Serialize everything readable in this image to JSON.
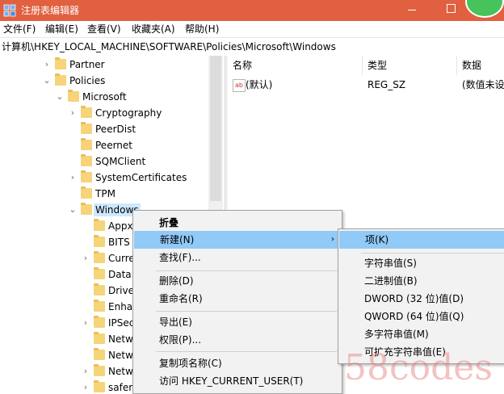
{
  "window": {
    "title": "注册表编辑器"
  },
  "menu": [
    "文件(F)",
    "编辑(E)",
    "查看(V)",
    "收藏夹(A)",
    "帮助(H)"
  ],
  "address": "计算机\\HKEY_LOCAL_MACHINE\\SOFTWARE\\Policies\\Microsoft\\Windows",
  "tree": [
    {
      "label": "Partner",
      "expand": "collapsed"
    },
    {
      "label": "Policies",
      "expand": "expanded"
    },
    {
      "label": "Microsoft",
      "expand": "expanded"
    },
    {
      "label": "Cryptography",
      "expand": "collapsed"
    },
    {
      "label": "PeerDist",
      "expand": "none"
    },
    {
      "label": "Peernet",
      "expand": "none"
    },
    {
      "label": "SQMClient",
      "expand": "none"
    },
    {
      "label": "SystemCertificates",
      "expand": "collapsed"
    },
    {
      "label": "TPM",
      "expand": "none"
    },
    {
      "label": "Windows",
      "expand": "expanded",
      "selected": true
    },
    {
      "label": "Appx",
      "expand": "none"
    },
    {
      "label": "BITS",
      "expand": "none"
    },
    {
      "label": "Curre",
      "expand": "collapsed"
    },
    {
      "label": "Data",
      "expand": "none"
    },
    {
      "label": "Drive",
      "expand": "none"
    },
    {
      "label": "Enha",
      "expand": "none"
    },
    {
      "label": "IPSec",
      "expand": "collapsed"
    },
    {
      "label": "Netw",
      "expand": "none"
    },
    {
      "label": "Netw",
      "expand": "none"
    },
    {
      "label": "Netw",
      "expand": "collapsed"
    },
    {
      "label": "safer",
      "expand": "collapsed"
    }
  ],
  "list": {
    "headers": [
      "名称",
      "类型",
      "数据"
    ],
    "rows": [
      {
        "icon": "ab",
        "name": "(默认)",
        "type": "REG_SZ",
        "data": "(数值未设"
      }
    ]
  },
  "context_menu": {
    "items": [
      "折叠",
      "新建(N)",
      "查找(F)...",
      "删除(D)",
      "重命名(R)",
      "导出(E)",
      "权限(P)...",
      "复制项名称(C)",
      "访问 HKEY_CURRENT_USER(T)"
    ],
    "submenu_arrow": "›"
  },
  "submenu": {
    "items": [
      "项(K)",
      "字符串值(S)",
      "二进制值(B)",
      "DWORD (32 位)值(D)",
      "QWORD (64 位)值(Q)",
      "多字符串值(M)",
      "可扩充字符串值(E)"
    ]
  },
  "watermark": "58codes",
  "colors": {
    "titlebar": "#e06040",
    "highlight": "#91c9f7",
    "folder": "#f5d47a"
  }
}
